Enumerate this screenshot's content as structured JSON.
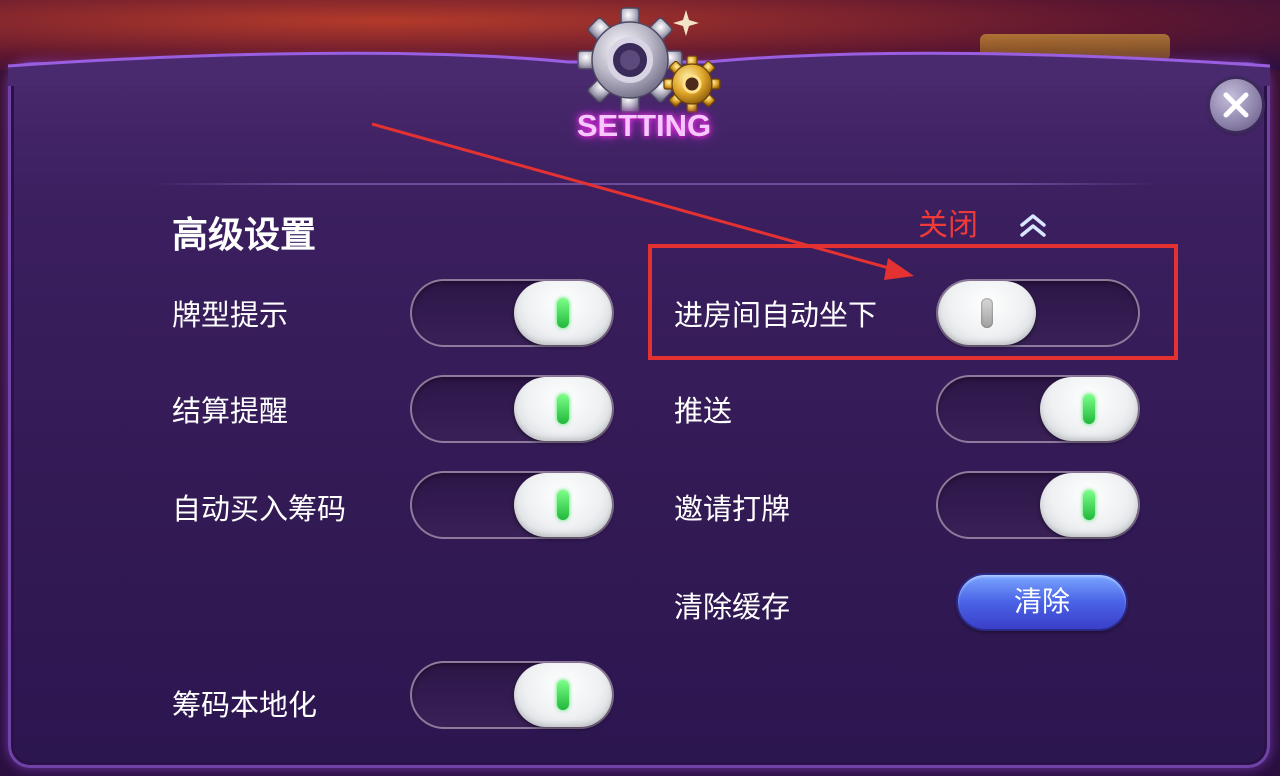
{
  "header": {
    "title": "SETTING"
  },
  "section": {
    "title": "高级设置"
  },
  "left_settings": [
    {
      "label": "牌型提示",
      "state": "on"
    },
    {
      "label": "结算提醒",
      "state": "on"
    },
    {
      "label": "自动买入筹码",
      "state": "on"
    },
    {
      "label": "筹码本地化",
      "state": "on"
    }
  ],
  "right_settings": [
    {
      "label": "进房间自动坐下",
      "state": "off"
    },
    {
      "label": "推送",
      "state": "on"
    },
    {
      "label": "邀请打牌",
      "state": "on"
    }
  ],
  "cache": {
    "label": "清除缓存",
    "button_label": "清除"
  },
  "annotation": {
    "text": "关闭",
    "color": "#e43232"
  },
  "colors": {
    "panel": "#3b1f5f",
    "toggle_on_indicator": "#1fb83a",
    "toggle_off_indicator": "#a0a0a0",
    "clear_button": "#4a63e6",
    "title_glow": "#ff3cf0"
  },
  "icons": {
    "settings": "gear-icon",
    "close": "close-icon",
    "chevron": "double-chevron-up-icon"
  }
}
